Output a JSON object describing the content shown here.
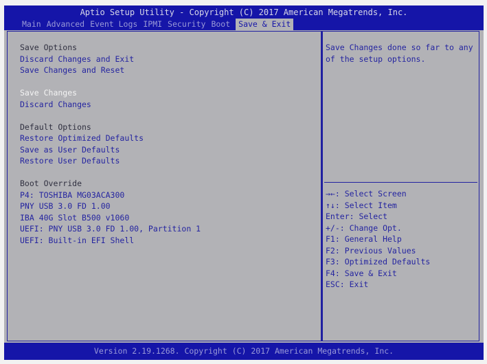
{
  "header": {
    "title": "Aptio Setup Utility - Copyright (C) 2017 American Megatrends, Inc.",
    "tabs": [
      "Main",
      "Advanced",
      "Event Logs",
      "IPMI",
      "Security",
      "Boot",
      "Save & Exit"
    ]
  },
  "left": {
    "sections": [
      {
        "heading": "Save Options",
        "items": [
          "Discard Changes and Exit",
          "Save Changes and Reset"
        ]
      },
      {
        "heading": "",
        "items": [
          "Save Changes",
          "Discard Changes"
        ]
      },
      {
        "heading": "Default Options",
        "items": [
          "Restore Optimized Defaults",
          "Save as User Defaults",
          "Restore User Defaults"
        ]
      },
      {
        "heading": "Boot Override",
        "items": [
          "P4: TOSHIBA MG03ACA300",
          "PNY USB 3.0 FD 1.00",
          "IBA 40G Slot B500 v1060",
          "UEFI: PNY USB 3.0 FD 1.00, Partition 1",
          "UEFI: Built-in EFI Shell"
        ]
      }
    ],
    "selected": "Save Changes"
  },
  "right": {
    "help": "Save Changes done so far to any of the setup options.",
    "keys": [
      "→←: Select Screen",
      "↑↓: Select Item",
      "Enter: Select",
      "+/-: Change Opt.",
      "F1: General Help",
      "F2: Previous Values",
      "F3: Optimized Defaults",
      "F4: Save & Exit",
      "ESC: Exit"
    ]
  },
  "footer": "Version 2.19.1268. Copyright (C) 2017 American Megatrends, Inc."
}
